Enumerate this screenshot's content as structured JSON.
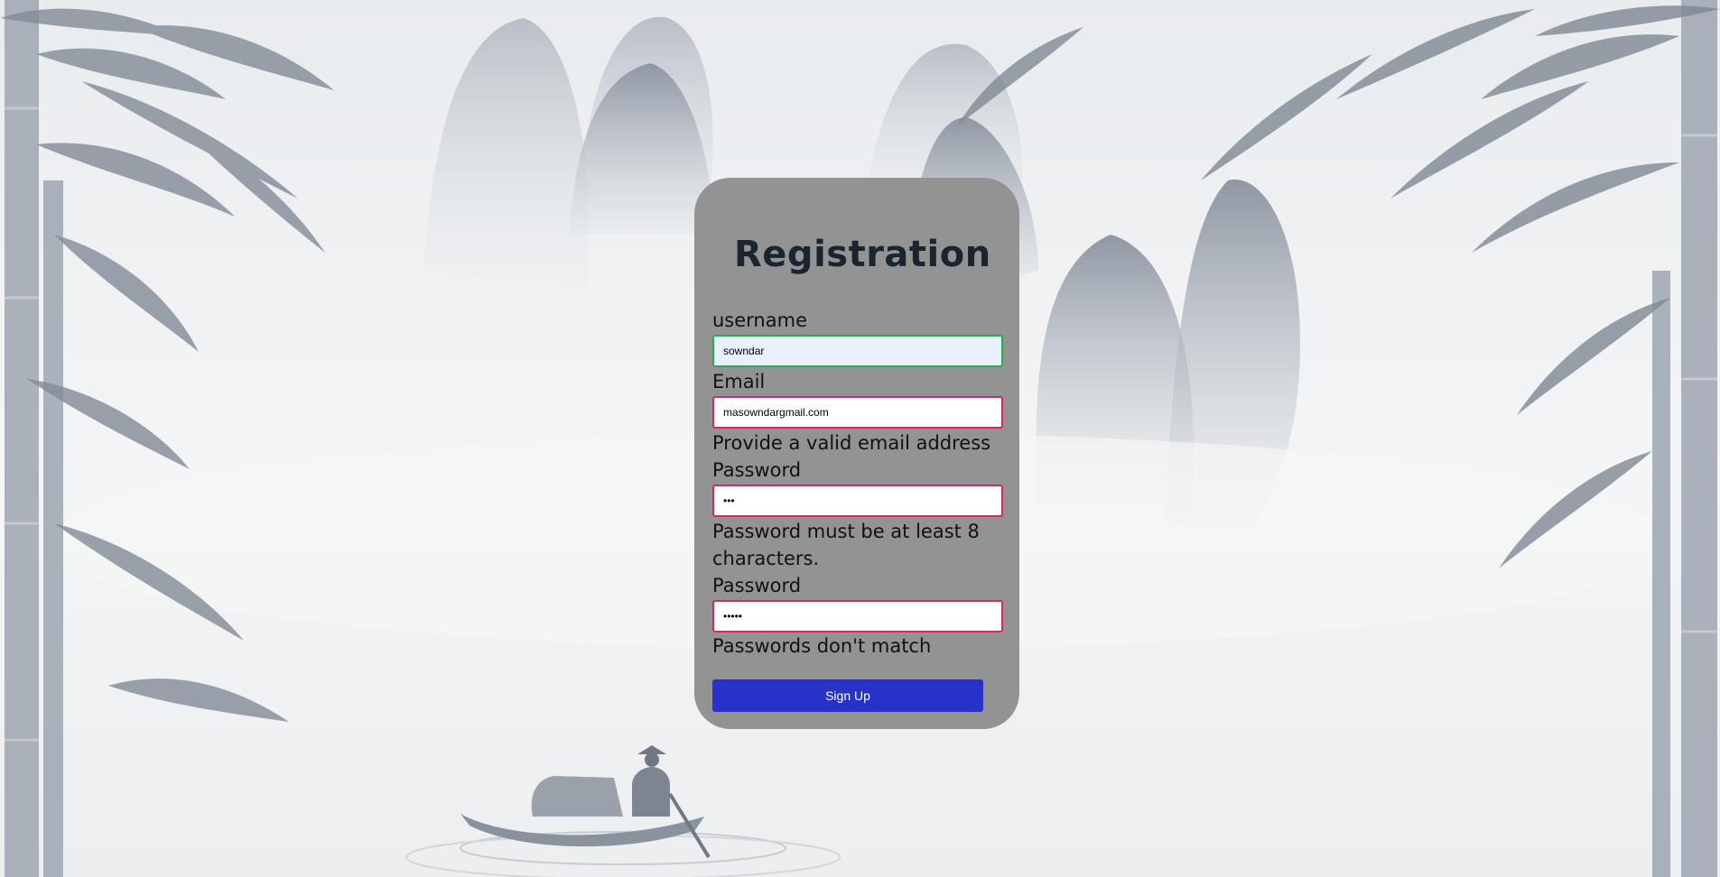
{
  "form": {
    "title": "Registration",
    "username_label": "username",
    "username_value": "sowndar",
    "email_label": "Email",
    "email_value": "masowndargmail.com",
    "email_error": "Provide a valid email address",
    "password_label": "Password",
    "password_value": "•••",
    "password_error": "Password must be at least 8 characters.",
    "confirm_label": "Password",
    "confirm_value": "•••••",
    "confirm_error": "Passwords don't match",
    "submit_label": "Sign Up"
  },
  "colors": {
    "card_bg": "#939393",
    "invalid_border": "#e0245e",
    "valid_border": "#22b04a",
    "button_bg": "#2832c8"
  }
}
